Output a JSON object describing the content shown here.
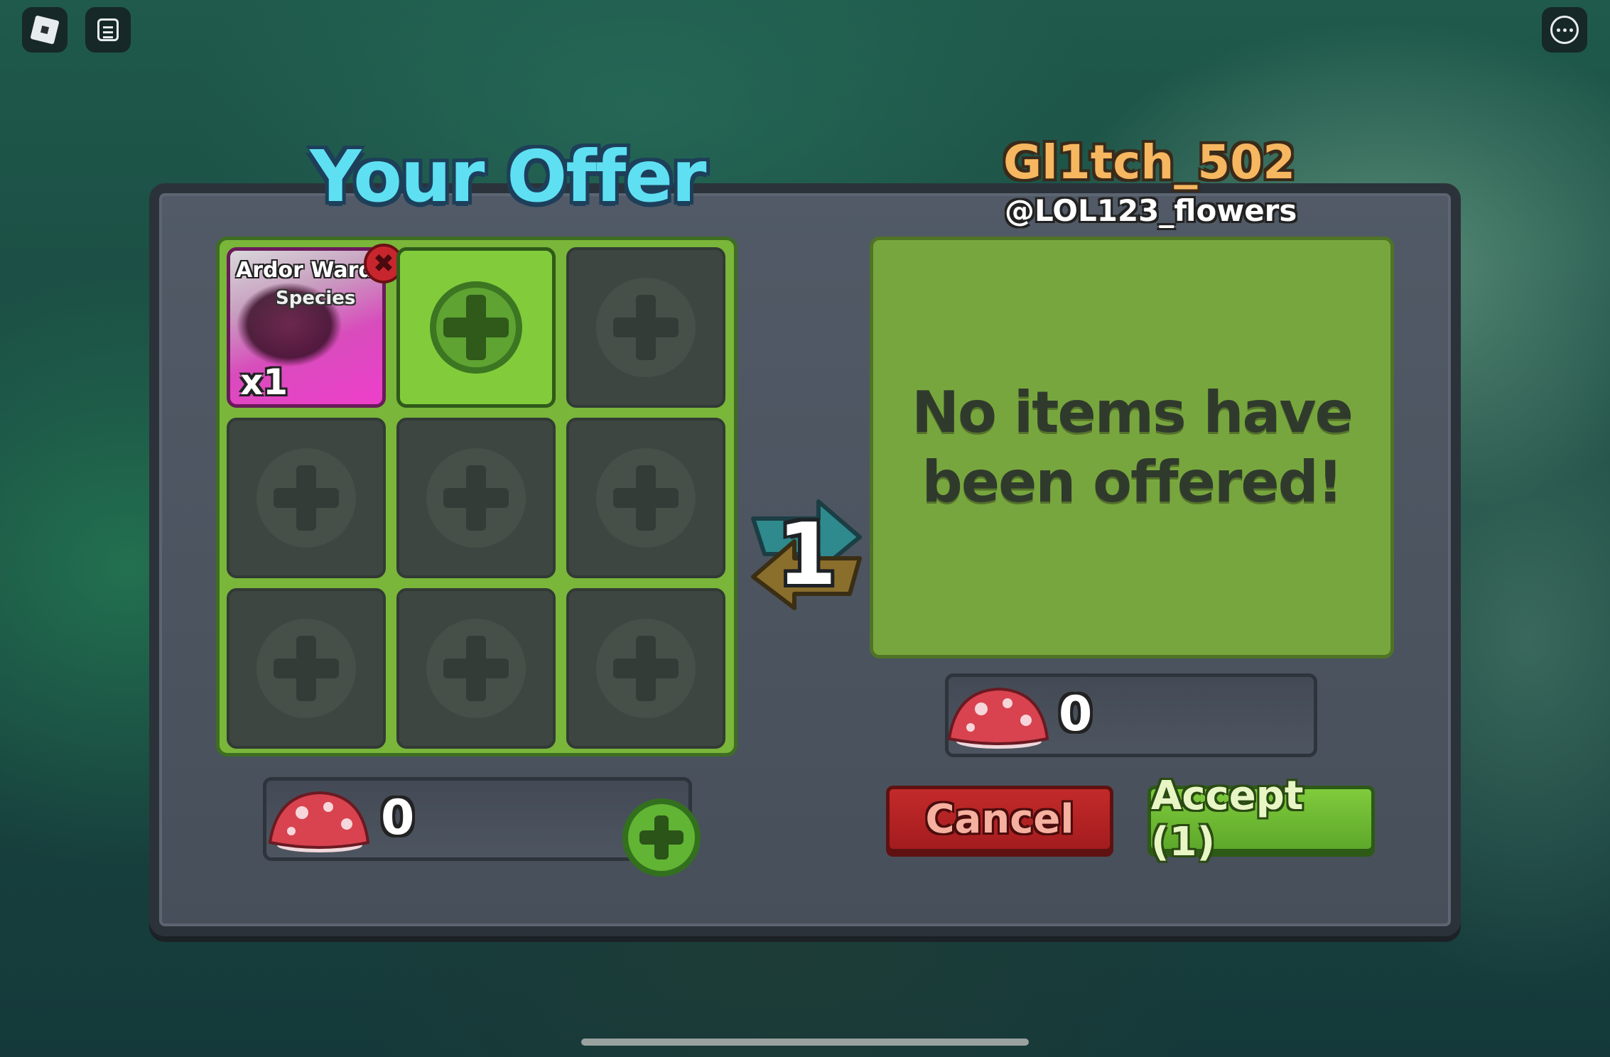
{
  "topbar": {
    "roblox_menu_icon": "roblox-logo-icon",
    "chat_icon": "chat-icon",
    "more_icon": "more-options-icon"
  },
  "your_offer": {
    "title": "Your Offer",
    "item": {
      "name": "Ardor Ward",
      "type": "Species",
      "quantity": "x1",
      "remove_icon": "close-icon"
    },
    "currency_value": "0",
    "currency_icon": "mushroom-icon"
  },
  "trade": {
    "swap_icon": "swap-arrows-icon",
    "count": "1"
  },
  "partner": {
    "display_name": "Gl1tch_502",
    "username": "@LOL123_flowers",
    "empty_message_line1": "No items have",
    "empty_message_line2": "been offered!",
    "currency_value": "0",
    "currency_icon": "mushroom-icon"
  },
  "actions": {
    "cancel_label": "Cancel",
    "accept_label": "Accept (1)"
  },
  "colors": {
    "title_cyan": "#5ee0f2",
    "partner_orange": "#f6b760",
    "grid_green": "#79b63a",
    "cancel_red": "#c32a2a",
    "accept_green": "#7fcb3c",
    "item_magenta": "#ee3fcb"
  }
}
